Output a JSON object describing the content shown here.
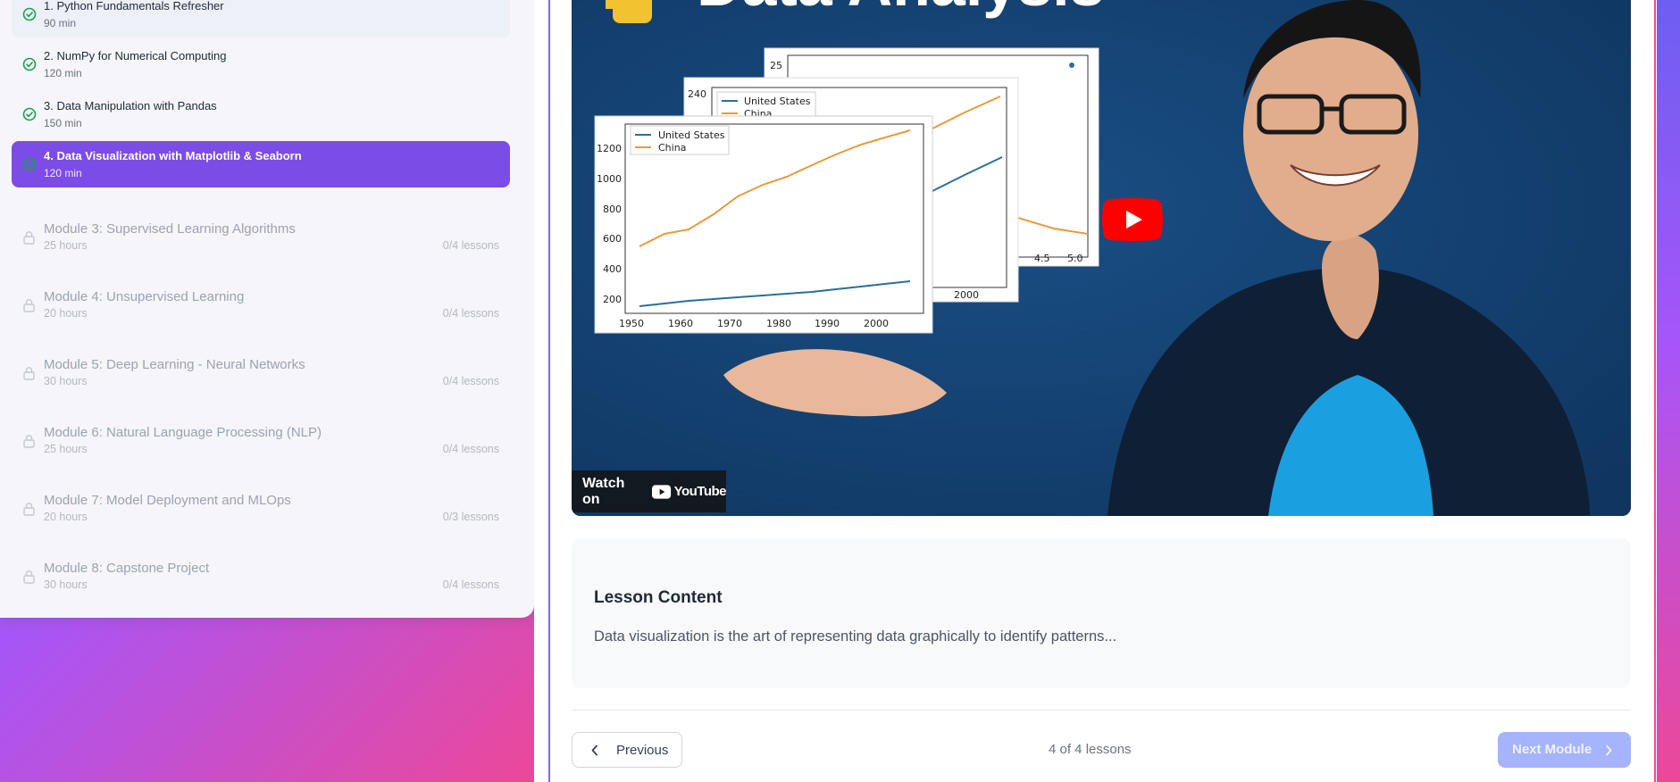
{
  "sidebar": {
    "lessons": [
      {
        "title": "1. Python Fundamentals Refresher",
        "meta": "90 min"
      },
      {
        "title": "2. NumPy for Numerical Computing",
        "meta": "120 min"
      },
      {
        "title": "3. Data Manipulation with Pandas",
        "meta": "150 min"
      },
      {
        "title": "4. Data Visualization with Matplotlib & Seaborn",
        "meta": "120 min"
      }
    ],
    "modules": [
      {
        "title": "Module 3: Supervised Learning Algorithms",
        "hours": "25 hours",
        "count": "0/4 lessons"
      },
      {
        "title": "Module 4: Unsupervised Learning",
        "hours": "20 hours",
        "count": "0/4 lessons"
      },
      {
        "title": "Module 5: Deep Learning - Neural Networks",
        "hours": "30 hours",
        "count": "0/4 lessons"
      },
      {
        "title": "Module 6: Natural Language Processing (NLP)",
        "hours": "25 hours",
        "count": "0/4 lessons"
      },
      {
        "title": "Module 7: Model Deployment and MLOps",
        "hours": "20 hours",
        "count": "0/3 lessons"
      },
      {
        "title": "Module 8: Capstone Project",
        "hours": "30 hours",
        "count": "0/4 lessons"
      }
    ]
  },
  "video": {
    "overlay_title": "Data Analysis",
    "watch_on": "Watch on",
    "youtube": "YouTube",
    "chart": {
      "legend": [
        "United States",
        "China"
      ],
      "y_ticks": [
        "1200",
        "1000",
        "800",
        "600",
        "400",
        "200"
      ],
      "x_ticks": [
        "1950",
        "1960",
        "1970",
        "1980",
        "1990",
        "2000"
      ],
      "back_y": "240",
      "back_y2": "25",
      "back_x": "2000",
      "back_x2": [
        "4.5",
        "5.0"
      ]
    }
  },
  "content": {
    "title": "Lesson Content",
    "text": "Data visualization is the art of representing data graphically to identify patterns..."
  },
  "footer": {
    "prev": "Previous",
    "progress": "4 of 4 lessons",
    "next": "Next Module"
  },
  "colors": {
    "accent": "#7c4ce6",
    "check": "#16a34a",
    "next_button": "#a5b4fc"
  }
}
